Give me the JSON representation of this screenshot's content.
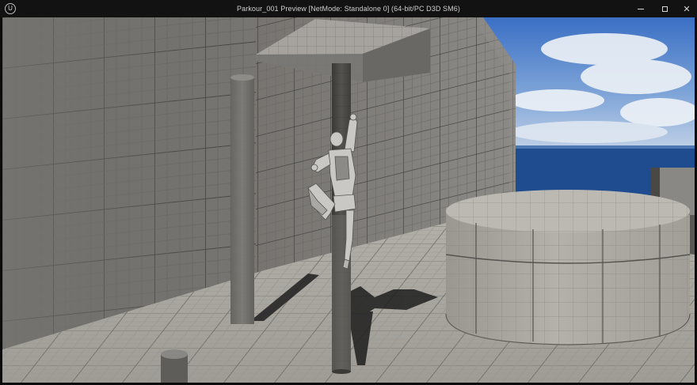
{
  "window": {
    "title": "Parkour_001 Preview [NetMode: Standalone 0]  (64-bit/PC D3D SM6)",
    "logo_icon": "unreal-engine-logo-icon",
    "controls": {
      "minimize_icon": "minimize-icon",
      "maximize_icon": "maximize-icon",
      "close_icon": "close-icon",
      "close_glyph": "✕"
    }
  },
  "scene": {
    "description_colors": {
      "sky_top": "#3f74c7",
      "sky_bottom": "#b9cde6",
      "ocean": "#1f4f93",
      "wall": "#6a6864",
      "floor": "#a7a49e",
      "cylinder": "#aaa7a1",
      "pole": "#4c4a47",
      "shadow": "#1c1c1c"
    }
  }
}
